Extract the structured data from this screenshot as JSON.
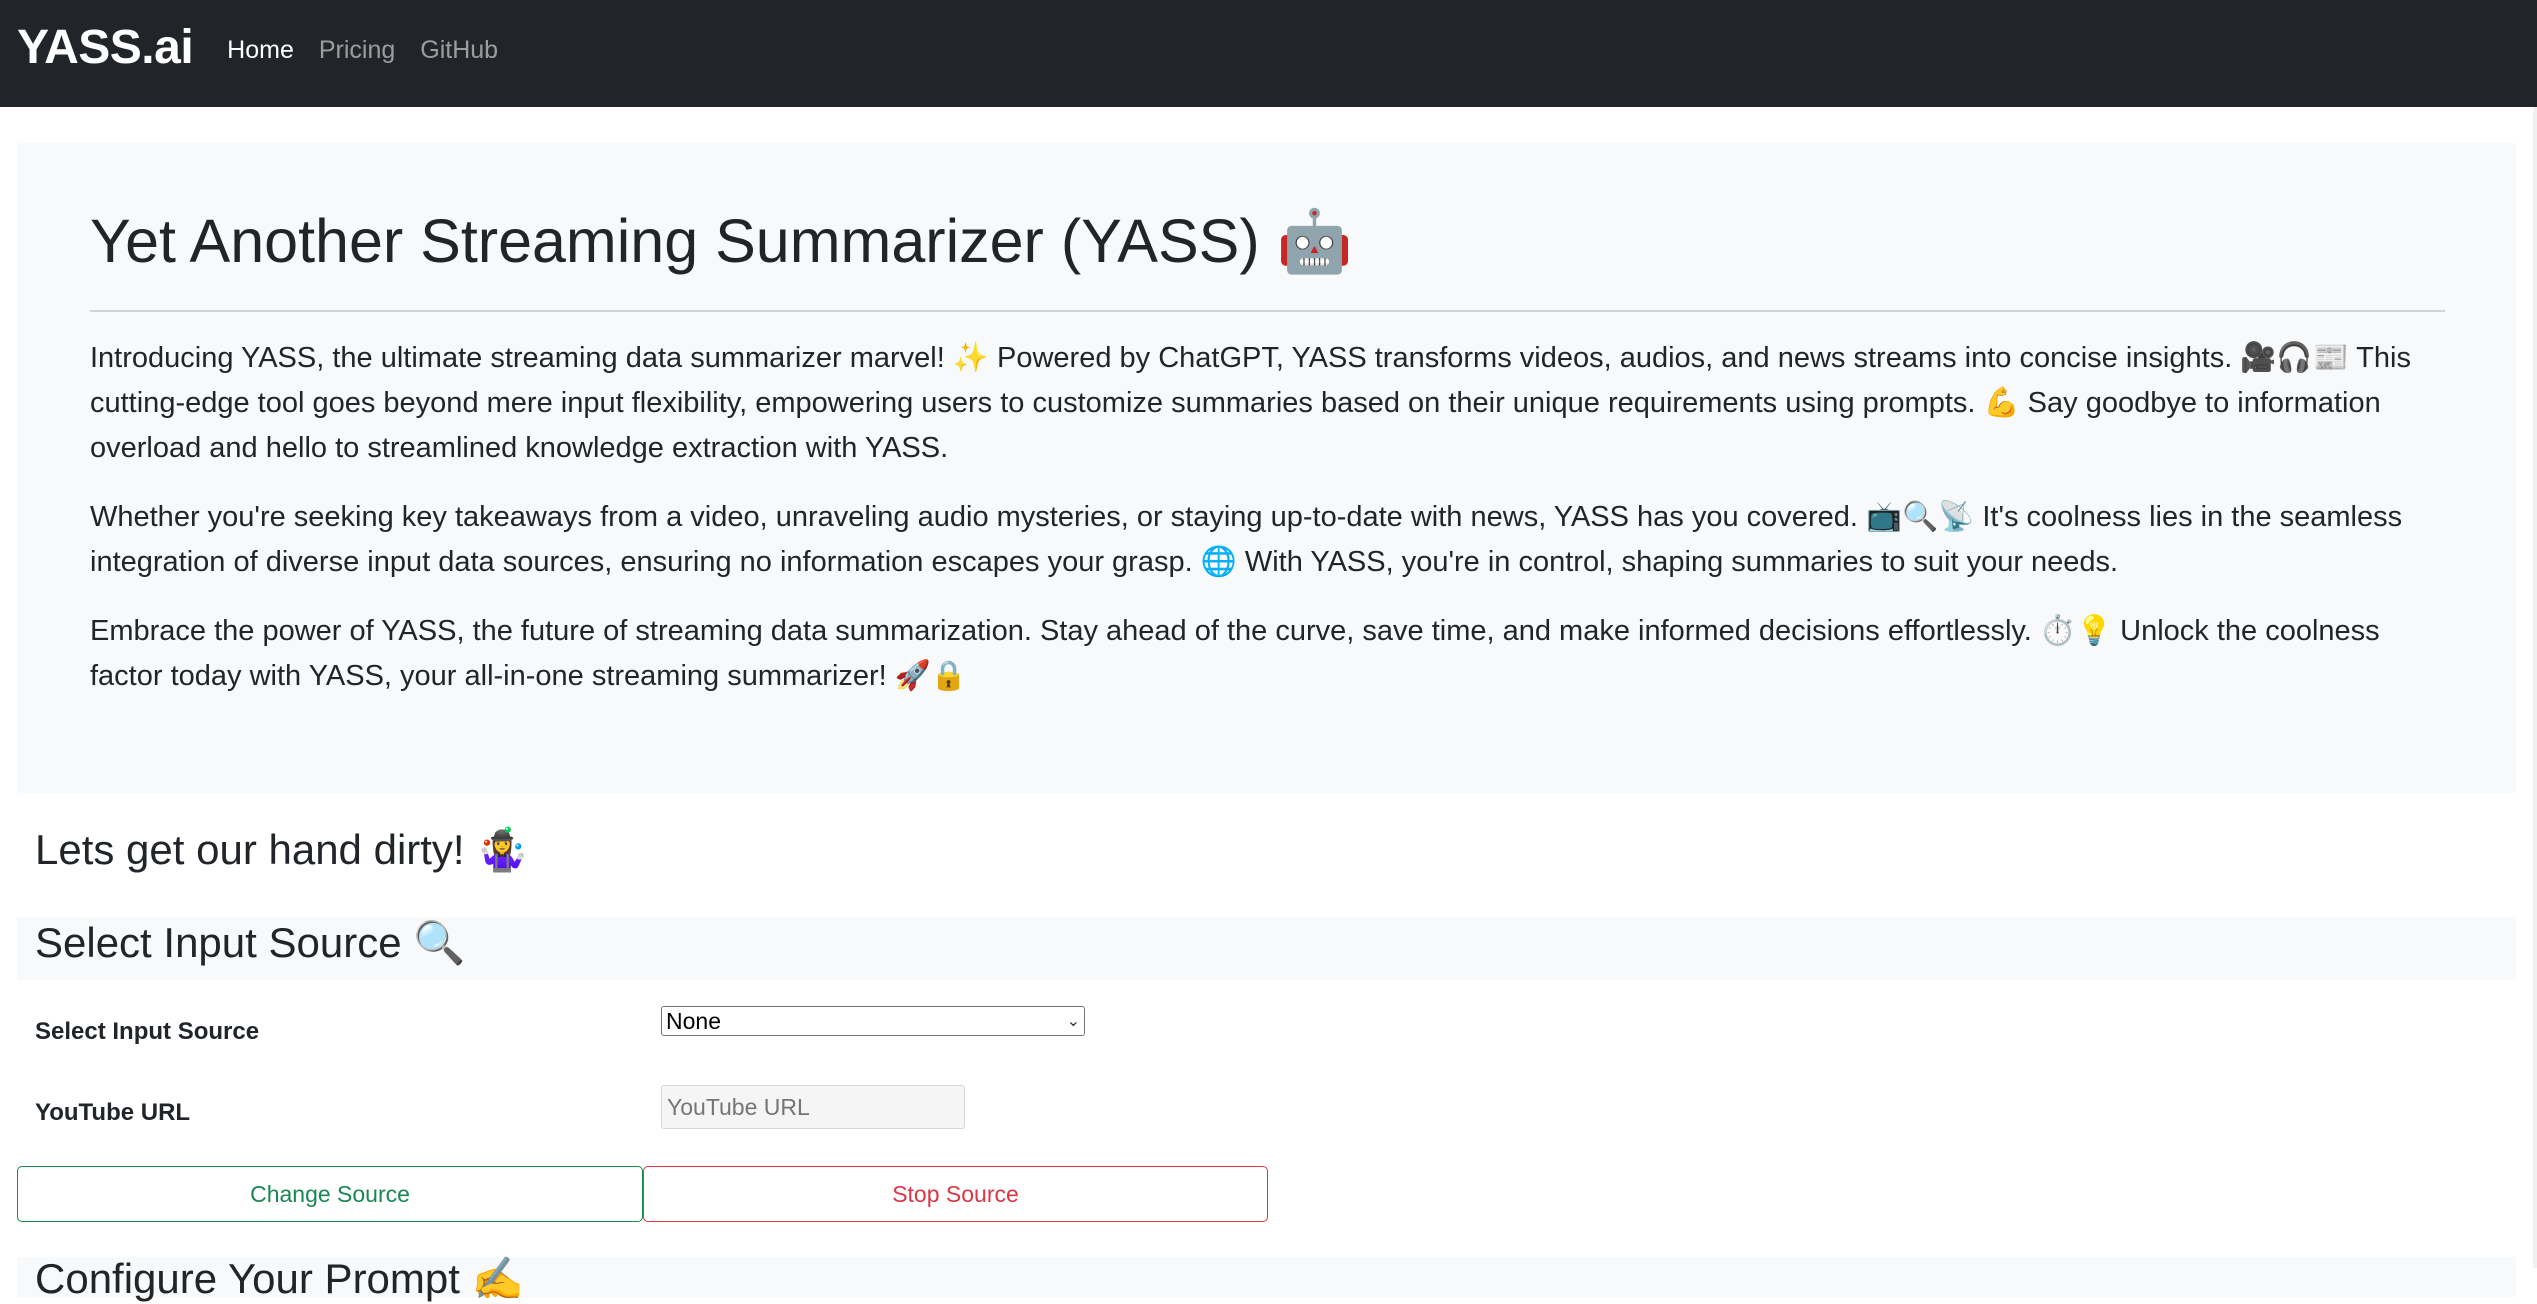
{
  "navbar": {
    "brand": "YASS.ai",
    "links": [
      {
        "label": "Home",
        "active": true
      },
      {
        "label": "Pricing",
        "active": false
      },
      {
        "label": "GitHub",
        "active": false
      }
    ]
  },
  "jumbotron": {
    "title": "Yet Another Streaming Summarizer (YASS) 🤖",
    "paragraphs": [
      "Introducing YASS, the ultimate streaming data summarizer marvel! ✨ Powered by ChatGPT, YASS transforms videos, audios, and news streams into concise insights. 🎥🎧📰 This cutting-edge tool goes beyond mere input flexibility, empowering users to customize summaries based on their unique requirements using prompts. 💪 Say goodbye to information overload and hello to streamlined knowledge extraction with YASS.",
      "Whether you're seeking key takeaways from a video, unraveling audio mysteries, or staying up-to-date with news, YASS has you covered. 📺🔍📡 It's coolness lies in the seamless integration of diverse input data sources, ensuring no information escapes your grasp. 🌐 With YASS, you're in control, shaping summaries to suit your needs.",
      "Embrace the power of YASS, the future of streaming data summarization. Stay ahead of the curve, save time, and make informed decisions effortlessly. ⏱️💡 Unlock the coolness factor today with YASS, your all-in-one streaming summarizer! 🚀🔒"
    ]
  },
  "main": {
    "intro_heading": "Lets get our hand dirty! 🤹‍♀️",
    "input_section": {
      "title": "Select Input Source 🔍",
      "source_label": "Select Input Source",
      "source_selected": "None",
      "url_label": "YouTube URL",
      "url_value": "",
      "url_placeholder": "YouTube URL",
      "change_button": "Change Source",
      "stop_button": "Stop Source"
    },
    "next_section_title": "Configure Your Prompt ✍️"
  },
  "colors": {
    "navbar_bg": "#212529",
    "panel_bg": "#f8f9fa",
    "success": "#198754",
    "danger": "#dc3545"
  }
}
